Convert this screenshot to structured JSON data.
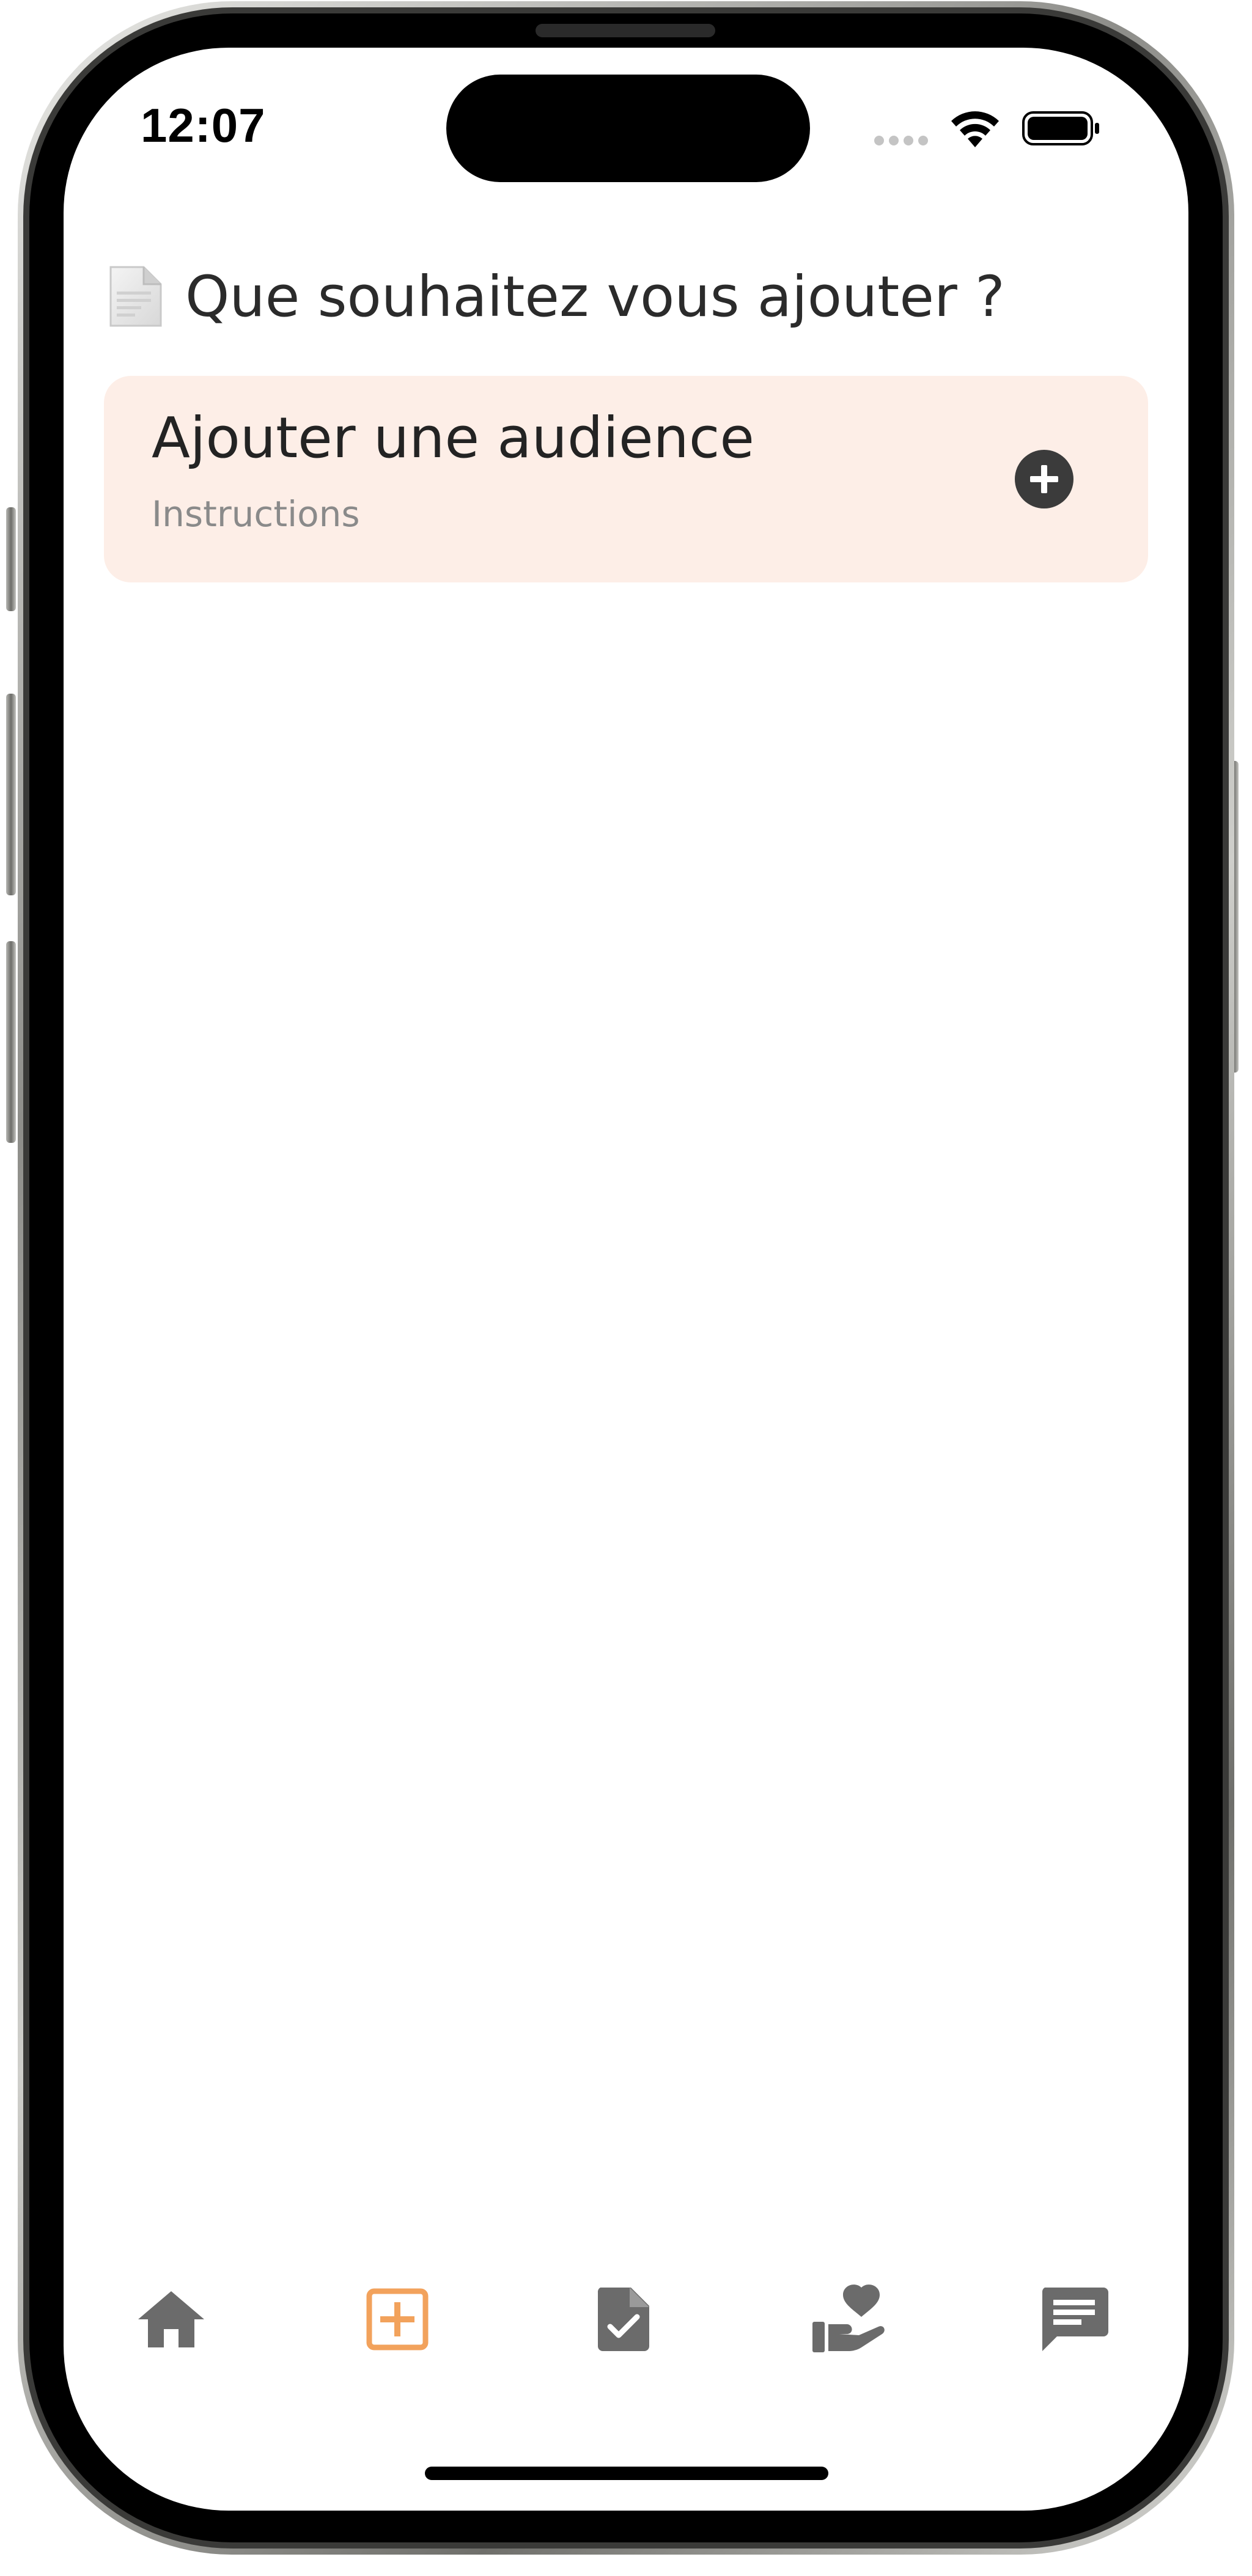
{
  "status_bar": {
    "time": "12:07"
  },
  "header": {
    "icon": "document-emoji-icon",
    "title": "Que souhaitez vous ajouter ?"
  },
  "options": [
    {
      "title": "Ajouter une audience",
      "subtitle": "Instructions",
      "icon": "plus-circle-icon"
    }
  ],
  "tab_bar": {
    "tabs": [
      {
        "name": "home",
        "icon": "home-icon",
        "active": false
      },
      {
        "name": "add",
        "icon": "plus-square-icon",
        "active": true
      },
      {
        "name": "documents",
        "icon": "document-check-icon",
        "active": false
      },
      {
        "name": "care",
        "icon": "hand-heart-icon",
        "active": false
      },
      {
        "name": "messages",
        "icon": "chat-icon",
        "active": false
      }
    ]
  },
  "colors": {
    "accent": "#f2a25c",
    "icon_inactive": "#6b6b6b",
    "card_background": "#fdeee7",
    "title_text": "#2b2b2b",
    "subtitle_text": "#8a8a8a"
  }
}
